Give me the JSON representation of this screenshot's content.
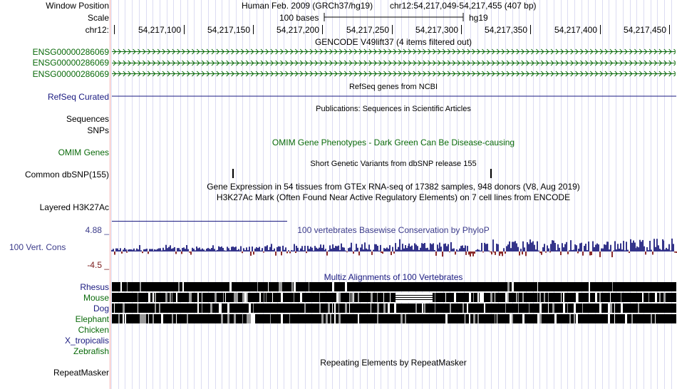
{
  "header": {
    "window_position_label": "Window Position",
    "scale_label": "Scale",
    "chrom_label": "chr12:",
    "assembly": "Human Feb. 2009 (GRCh37/hg19)",
    "position": "chr12:54,217,049-54,217,455 (407 bp)",
    "scale_text": "100 bases",
    "db": "hg19",
    "ruler_ticks": [
      "54,217,100",
      "54,217,150",
      "54,217,200",
      "54,217,250",
      "54,217,300",
      "54,217,350",
      "54,217,400",
      "54,217,450"
    ]
  },
  "tracks": {
    "gencode": {
      "title": "GENCODE V49lift37 (4 items filtered out)",
      "genes": [
        "ENSG00000286069",
        "ENSG00000286069",
        "ENSG00000286069"
      ],
      "color": "#0a6a0a"
    },
    "refseq": {
      "label": "RefSeq Curated",
      "title": "RefSeq genes from NCBI"
    },
    "publications": {
      "label": "Sequences",
      "title": "Publications: Sequences in Scientific Articles"
    },
    "snps": {
      "label": "SNPs"
    },
    "omim": {
      "label": "OMIM Genes",
      "title": "OMIM Gene Phenotypes - Dark Green Can Be Disease-causing"
    },
    "dbsnp": {
      "label": "Common dbSNP(155)",
      "title": "Short Genetic Variants from dbSNP release 155"
    },
    "gtex": {
      "title": "Gene Expression in 54 tissues from GTEx RNA-seq of 17382 samples, 948 donors (V8, Aug 2019)"
    },
    "h3k27ac": {
      "label": "Layered H3K27Ac",
      "title": "H3K27Ac Mark (Often Found Near Active Regulatory Elements) on 7 cell lines from ENCODE"
    },
    "conservation": {
      "label": "100 Vert. Cons",
      "title": "100 vertebrates Basewise Conservation by PhyloP",
      "max": "4.88 _",
      "min": "-4.5 _",
      "pos_color": "#34348a",
      "neg_color": "#8a2a2a"
    },
    "multiz": {
      "title": "Multiz Alignments of 100 Vertebrates",
      "species": [
        {
          "name": "Rhesus"
        },
        {
          "name": "Mouse"
        },
        {
          "name": "Dog"
        },
        {
          "name": "Elephant"
        },
        {
          "name": "Chicken"
        },
        {
          "name": "X_tropicalis"
        },
        {
          "name": "Zebrafish"
        }
      ]
    },
    "repeatmasker": {
      "label": "RepeatMasker",
      "title": "Repeating Elements by RepeatMasker"
    }
  }
}
